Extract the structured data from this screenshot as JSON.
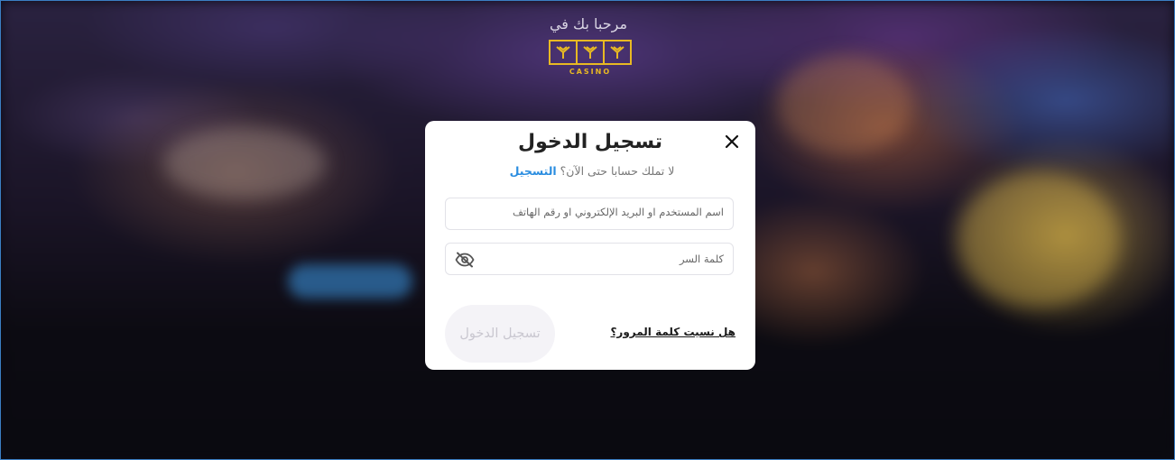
{
  "page": {
    "welcome_text": "مرحبا بك في",
    "logo_caption": "CASINO"
  },
  "login_modal": {
    "title": "تسجيل الدخول",
    "no_account_text": "لا تملك حسابا حتى الآن؟",
    "signup_link": "التسجيل",
    "username_placeholder": "اسم المستخدم او البريد الإلكتروني او رقم الهاتف",
    "password_placeholder": "كلمة السر",
    "submit_label": "تسجيل الدخول",
    "forgot_password_link": "هل نسيت كلمة المرور؟"
  },
  "icons": {
    "close": "close-icon",
    "password_toggle": "eye-off-icon",
    "logo": "casino-logo"
  },
  "colors": {
    "brand_gold": "#e8b923",
    "link_blue": "#2a8de0",
    "modal_bg": "#ffffff",
    "disabled_button_bg": "#f4f3f7"
  }
}
